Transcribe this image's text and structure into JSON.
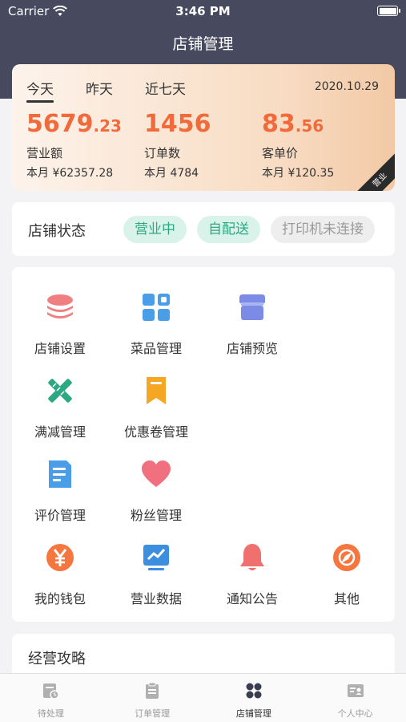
{
  "status_bar": {
    "carrier": "Carrier",
    "time": "3:46 PM"
  },
  "nav": {
    "title": "店铺管理"
  },
  "stats": {
    "tabs": [
      "今天",
      "昨天",
      "近七天"
    ],
    "date": "2020.10.29",
    "items": [
      {
        "int": "5679",
        "dec": ".23",
        "label": "营业额",
        "month": "本月 ¥62357.28"
      },
      {
        "int": "1456",
        "dec": "",
        "label": "订单数",
        "month": "本月 4784"
      },
      {
        "int": "83",
        "dec": ".56",
        "label": "客单价",
        "month": "本月 ¥120.35"
      }
    ],
    "corner_tag": "营业"
  },
  "store_status": {
    "title": "店铺状态",
    "open": "营业中",
    "delivery": "自配送",
    "printer": "打印机未连接"
  },
  "menu": [
    {
      "label": "店铺设置",
      "icon": "layers-icon"
    },
    {
      "label": "菜品管理",
      "icon": "grid-icon"
    },
    {
      "label": "店铺预览",
      "icon": "shop-icon"
    },
    {
      "label": "满减管理",
      "icon": "ruler-pencil-icon"
    },
    {
      "label": "优惠卷管理",
      "icon": "bookmark-icon"
    },
    {
      "label": "评价管理",
      "icon": "document-icon"
    },
    {
      "label": "粉丝管理",
      "icon": "heart-icon"
    },
    {
      "label": "我的钱包",
      "icon": "yen-icon"
    },
    {
      "label": "营业数据",
      "icon": "chart-icon"
    },
    {
      "label": "通知公告",
      "icon": "bell-icon"
    },
    {
      "label": "其他",
      "icon": "compass-icon"
    }
  ],
  "guide": {
    "title": "经营攻略"
  },
  "tabbar": [
    {
      "label": "待处理",
      "icon": "pending-icon"
    },
    {
      "label": "订单管理",
      "icon": "orders-icon"
    },
    {
      "label": "店铺管理",
      "icon": "store-icon"
    },
    {
      "label": "个人中心",
      "icon": "profile-icon"
    }
  ],
  "colors": {
    "header": "#474a5e",
    "accent": "#f06a3b",
    "green": "#2ca883",
    "blue": "#4a9ee8",
    "pink": "#f08080",
    "orange": "#f5a623"
  }
}
